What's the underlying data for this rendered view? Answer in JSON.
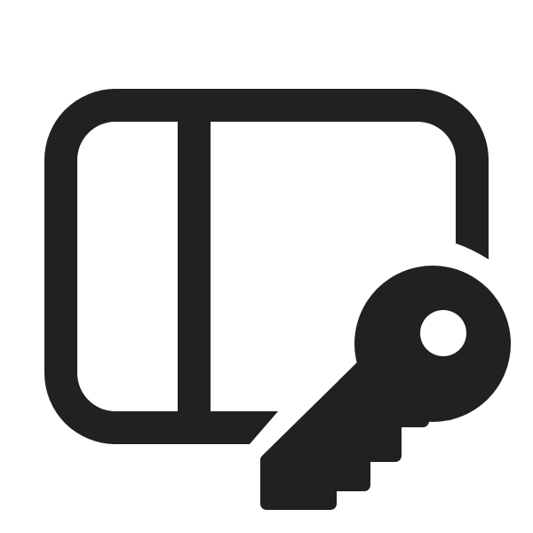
{
  "icon": {
    "name": "panel-left-key-icon",
    "color": "#212121",
    "background": "#ffffff"
  }
}
